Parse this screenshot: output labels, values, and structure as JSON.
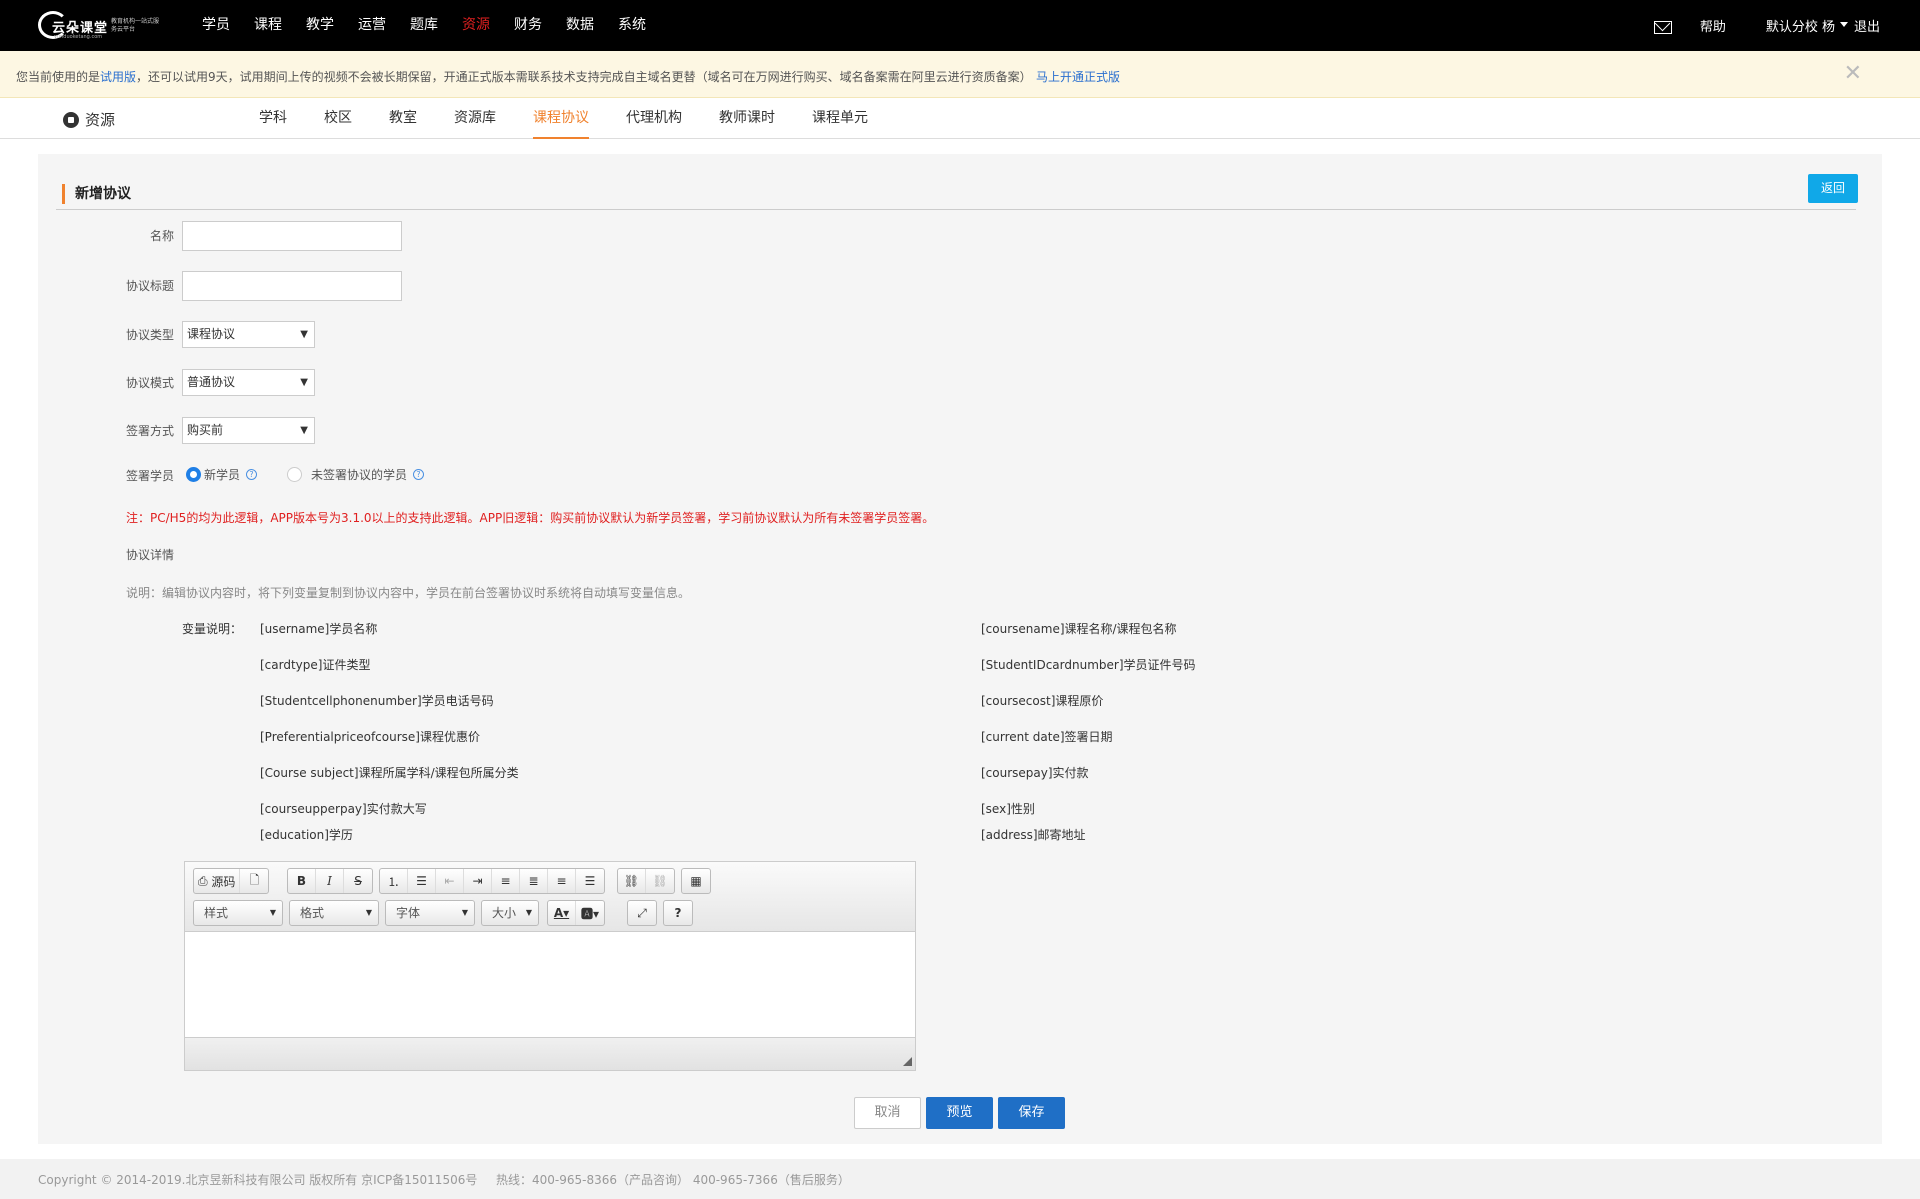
{
  "logo": {
    "brand": "云朵课堂",
    "sub": "教育机构一站式服务云平台",
    "url": "yunduoketang.com"
  },
  "nav": {
    "items": [
      "学员",
      "课程",
      "教学",
      "运营",
      "题库",
      "资源",
      "财务",
      "数据",
      "系统"
    ],
    "active": "资源"
  },
  "top_right": {
    "help": "帮助",
    "school": "默认分校 杨",
    "logout": "退出"
  },
  "notice": {
    "prefix": "您当前使用的是",
    "trial": "试用版",
    "rest": "，还可以试用9天，试用期间上传的视频不会被长期保留，开通正式版本需联系技术支持完成自主域名更替（域名可在万网进行购买、域名备案需在阿里云进行资质备案）",
    "upgrade": "马上开通正式版",
    "close": "✕"
  },
  "subnav": {
    "title": "资源",
    "tabs": [
      "学科",
      "校区",
      "教室",
      "资源库",
      "课程协议",
      "代理机构",
      "教师课时",
      "课程单元"
    ],
    "active": "课程协议"
  },
  "form": {
    "title": "新增协议",
    "back": "返回",
    "name_label": "名称",
    "name_value": "",
    "title_label": "协议标题",
    "title_value": "",
    "type_label": "协议类型",
    "type_value": "课程协议",
    "mode_label": "协议模式",
    "mode_value": "普通协议",
    "sign_label": "签署方式",
    "sign_value": "购买前",
    "student_label": "签署学员",
    "student_options": [
      "新学员",
      "未签署协议的学员"
    ],
    "student_selected": "新学员",
    "note": "注：PC/H5的均为此逻辑，APP版本号为3.1.0以上的支持此逻辑。APP旧逻辑：购买前协议默认为新学员签署，学习前协议默认为所有未签署学员签署。",
    "detail_label": "协议详情",
    "explain": "说明：编辑协议内容时，将下列变量复制到协议内容中，学员在前台签署协议时系统将自动填写变量信息。",
    "var_label": "变量说明：",
    "vars_left": [
      "[username]学员名称",
      "[cardtype]证件类型",
      "[Studentcellphonenumber]学员电话号码",
      "[Preferentialpriceofcourse]课程优惠价",
      "[Course subject]课程所属学科/课程包所属分类",
      "[courseupperpay]实付款大写",
      "[education]学历"
    ],
    "vars_right": [
      "[coursename]课程名称/课程包名称",
      "[StudentIDcardnumber]学员证件号码",
      "[coursecost]课程原价",
      "[current date]签署日期",
      "[coursepay]实付款",
      "[sex]性别",
      "[address]邮寄地址"
    ]
  },
  "editor": {
    "source": "源码",
    "combos": [
      "样式",
      "格式",
      "字体",
      "大小"
    ],
    "icons": [
      "source-icon",
      "new-page-icon",
      "bold-icon",
      "italic-icon",
      "strike-icon",
      "ordered-list-icon",
      "bullet-list-icon",
      "outdent-icon",
      "indent-icon",
      "align-left-icon",
      "align-center-icon",
      "align-right-icon",
      "justify-icon",
      "link-icon",
      "unlink-icon",
      "table-icon",
      "text-color-icon",
      "bg-color-icon",
      "maximize-icon",
      "help-icon"
    ],
    "content": ""
  },
  "actions": {
    "cancel": "取消",
    "preview": "预览",
    "save": "保存"
  },
  "footer": {
    "copyright": "Copyright © 2014-2019.北京昱新科技有限公司 版权所有 京ICP备15011506号",
    "hotline": "热线：400-965-8366（产品咨询） 400-965-7366（售后服务）"
  },
  "colors": {
    "accent": "#f0822e",
    "primary": "#1f6fc6",
    "back_button": "#10a8e8",
    "warning": "#e02020"
  }
}
